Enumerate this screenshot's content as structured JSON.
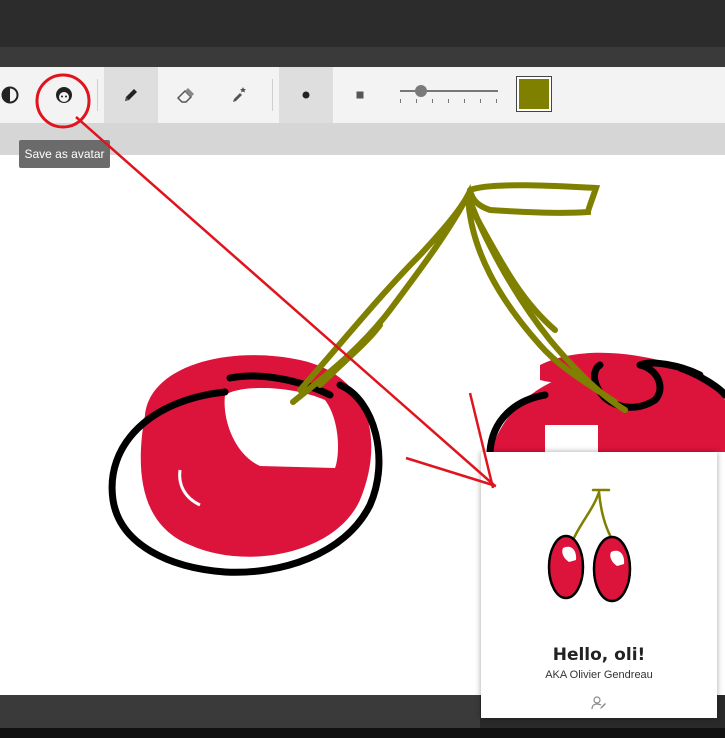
{
  "toolbar": {
    "buttons": [
      {
        "name": "theme-toggle",
        "icon": "contrast-icon"
      },
      {
        "name": "save-as-avatar",
        "icon": "avatar-face-icon",
        "tooltip": "Save as avatar"
      },
      {
        "name": "pencil-tool",
        "icon": "pencil-icon",
        "active": true
      },
      {
        "name": "eraser-tool",
        "icon": "eraser-icon"
      },
      {
        "name": "magic-tool",
        "icon": "magic-wand-icon"
      },
      {
        "name": "round-brush",
        "icon": "circle-dot-icon",
        "active": true
      },
      {
        "name": "square-brush",
        "icon": "square-dot-icon"
      }
    ],
    "brush_size_fraction": 0.18,
    "selected_color": "#808000"
  },
  "tooltip": {
    "text": "Save as avatar"
  },
  "avatar_card": {
    "greeting": "Hello, oli!",
    "aka": "AKA Olivier Gendreau",
    "edit_icon": "edit-profile-icon"
  },
  "colors": {
    "cherry_red": "#dc143c",
    "stem_olive": "#808000",
    "outline": "#000000",
    "annotation_red": "#e0141e"
  }
}
